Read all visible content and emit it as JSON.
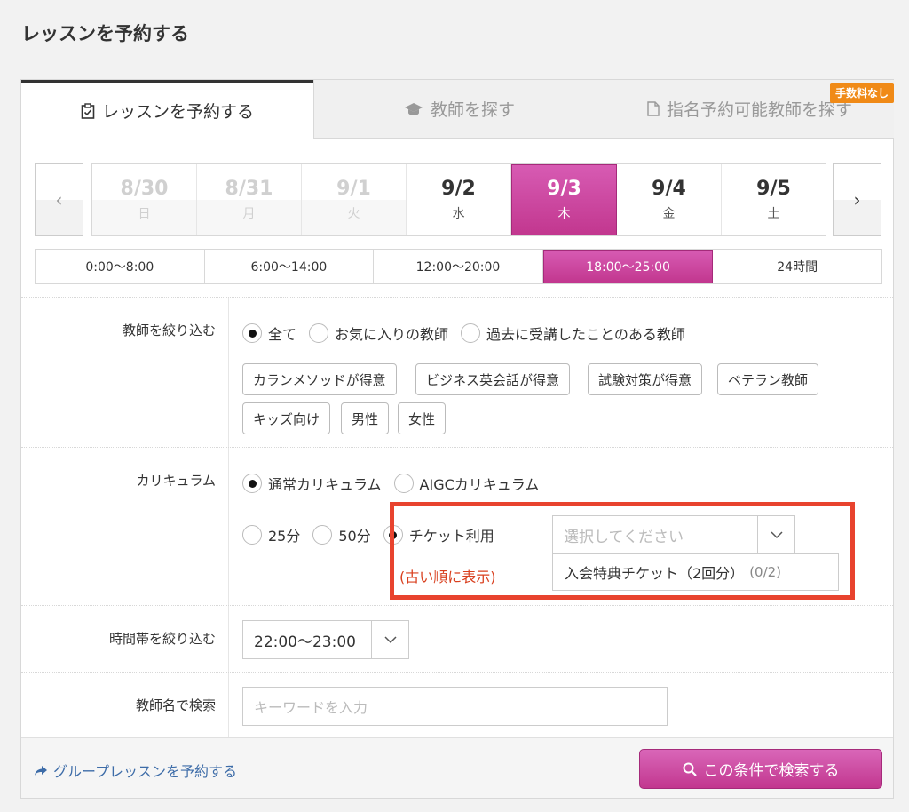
{
  "page_title": "レッスンを予約する",
  "tabs": {
    "book": "レッスンを予約する",
    "find_teacher": "教師を探す",
    "nominate": "指名予約可能教師を探す",
    "fee_badge": "手数料なし"
  },
  "date_nav": {
    "prev": "‹",
    "next": "›"
  },
  "dates": [
    {
      "date": "8/30",
      "day": "日",
      "state": "past"
    },
    {
      "date": "8/31",
      "day": "月",
      "state": "past"
    },
    {
      "date": "9/1",
      "day": "火",
      "state": "past"
    },
    {
      "date": "9/2",
      "day": "水",
      "state": "normal"
    },
    {
      "date": "9/3",
      "day": "木",
      "state": "selected"
    },
    {
      "date": "9/4",
      "day": "金",
      "state": "normal"
    },
    {
      "date": "9/5",
      "day": "土",
      "state": "normal"
    }
  ],
  "time_slots": [
    {
      "label": "0:00〜8:00",
      "selected": false
    },
    {
      "label": "6:00〜14:00",
      "selected": false
    },
    {
      "label": "12:00〜20:00",
      "selected": false
    },
    {
      "label": "18:00〜25:00",
      "selected": true
    },
    {
      "label": "24時間",
      "selected": false
    }
  ],
  "teacher_filter": {
    "label": "教師を絞り込む",
    "options": [
      {
        "label": "全て",
        "checked": true
      },
      {
        "label": "お気に入りの教師",
        "checked": false
      },
      {
        "label": "過去に受講したことのある教師",
        "checked": false
      }
    ],
    "tags": [
      "カランメソッドが得意",
      "ビジネス英会話が得意",
      "試験対策が得意",
      "ベテラン教師",
      "キッズ向け",
      "男性",
      "女性"
    ]
  },
  "curriculum": {
    "label": "カリキュラム",
    "options": [
      {
        "label": "通常カリキュラム",
        "checked": true
      },
      {
        "label": "AIGCカリキュラム",
        "checked": false
      }
    ],
    "durations": [
      {
        "label": "25分",
        "checked": false
      },
      {
        "label": "50分",
        "checked": false
      },
      {
        "label": "チケット利用",
        "checked": true
      }
    ],
    "ticket_select_placeholder": "選択してください",
    "ticket_option": "入会特典チケット（2回分）",
    "ticket_count": "(0/2)",
    "order_note": "(古い順に表示)"
  },
  "time_filter": {
    "label": "時間帯を絞り込む",
    "value": "22:00〜23:00"
  },
  "teacher_search": {
    "label": "教師名で検索",
    "placeholder": "キーワードを入力"
  },
  "footer": {
    "group_link": "グループレッスンを予約する",
    "search_button": "この条件で検索する"
  },
  "colors": {
    "accent": "#c2378f",
    "highlight": "#e8432e",
    "link": "#3d6ca8",
    "badge": "#f08a17"
  }
}
